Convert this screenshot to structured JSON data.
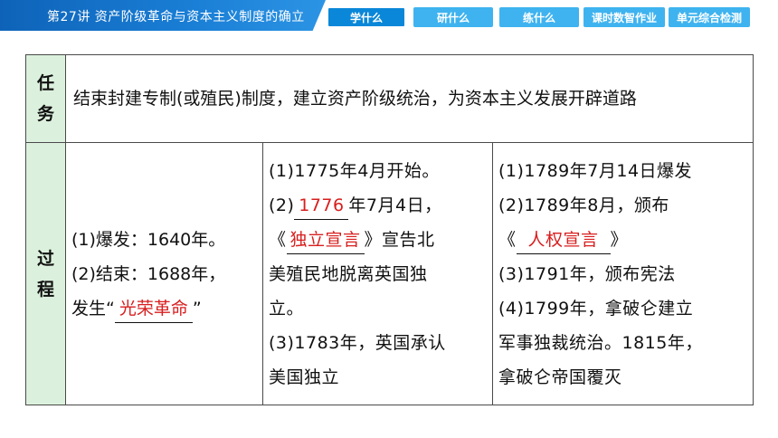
{
  "header": {
    "title": "第27讲   资产阶级革命与资本主义制度的确立",
    "tabs": [
      {
        "label": "学什么",
        "active": true
      },
      {
        "label": "研什么",
        "active": false
      },
      {
        "label": "练什么",
        "active": false
      },
      {
        "label": "课时数智作业",
        "active": false
      },
      {
        "label": "单元综合检测",
        "active": false
      }
    ]
  },
  "table": {
    "task_header": "任务",
    "task_text": "结束封建专制(或殖民)制度，建立资产阶级统治，为资本主义发展开辟道路",
    "process_header": "过程",
    "england": {
      "line1": "(1)爆发：1640年。",
      "line2": "(2)结束：1688年，",
      "line3_prefix": "发生“",
      "answer": "光荣革命",
      "line3_suffix": "”"
    },
    "usa": {
      "line1": "(1)1775年4月开始。",
      "line2_prefix": "(2)",
      "answer1": "1776",
      "line2_suffix": "年7月4日，",
      "line3_prefix": "《",
      "answer2": "独立宣言",
      "line3_suffix": "》宣告北",
      "line4": "美殖民地脱离英国独",
      "line5": "立。",
      "line6": "(3)1783年，英国承认",
      "line7": "美国独立"
    },
    "france": {
      "line1": "(1)1789年7月14日爆发",
      "line2": "(2)1789年8月，颁布",
      "line3_prefix": "《",
      "answer": "人权宣言",
      "line3_suffix": "》",
      "line4": "(3)1791年，颁布宪法",
      "line5": "(4)1799年，拿破仑建立",
      "line6": "军事独裁统治。1815年，",
      "line7": "拿破仑帝国覆灭"
    }
  }
}
